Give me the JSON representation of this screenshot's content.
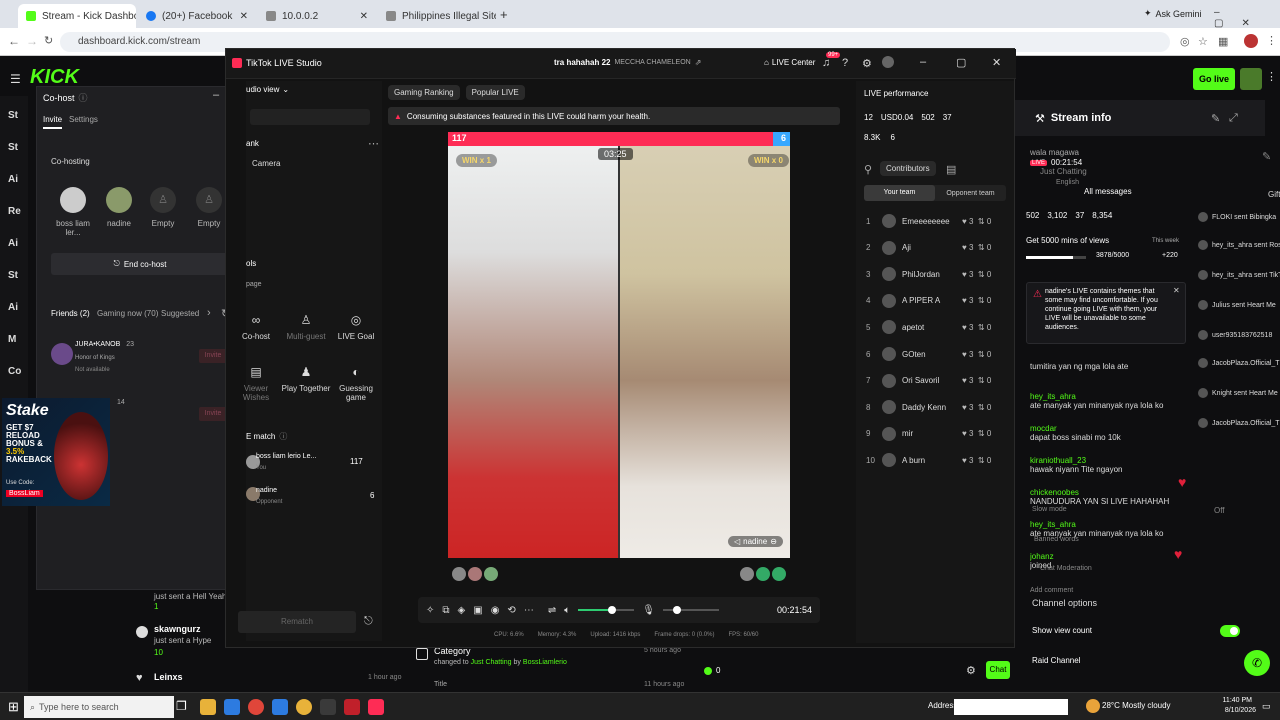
{
  "browser": {
    "tabs": [
      {
        "label": "Stream - Kick Dashboard",
        "color": "#53fc18"
      },
      {
        "label": "(20+) Facebook",
        "color": "#1877f2"
      },
      {
        "label": "10.0.0.2",
        "color": "#888888"
      },
      {
        "label": "Philippines Illegal Site Promoti",
        "color": "#888888"
      }
    ],
    "new_tab": "+",
    "url": "dashboard.kick.com/stream",
    "ask": "Ask Gemini"
  },
  "kick": {
    "logo": "KICK",
    "go_live": "Go live",
    "side_badges": [
      "St",
      "St",
      "Ai",
      "Re",
      "Ai",
      "St",
      "Ai",
      "M",
      "Co"
    ],
    "stream_info": "Stream info",
    "settings_label": "Gift",
    "cohost": {
      "title": "Co-host",
      "tabs": [
        "Invite",
        "Settings"
      ],
      "section": "Co-hosting",
      "slots": [
        {
          "label": "boss liam ler..."
        },
        {
          "label": "nadine"
        },
        {
          "label": "Empty"
        },
        {
          "label": "Empty"
        }
      ],
      "end_button": "End co-host",
      "filter_tabs": [
        "Friends (2)",
        "Gaming now (70)",
        "Suggested"
      ],
      "friends": [
        {
          "name": "JURA•KANOB",
          "count": "23",
          "game": "Honor of Kings",
          "status": "Not available",
          "action": "Invite"
        },
        {
          "name": "",
          "count": "14",
          "game": "",
          "status": "",
          "action": "Invite"
        }
      ]
    },
    "ad": {
      "brand": "Stake",
      "line1": "GET $7",
      "line2": "RELOAD",
      "line3": "BONUS &",
      "line4": "3.5%",
      "line5": "RAKEBACK",
      "code_label": "Use Code:",
      "code": "BossLiam"
    },
    "activity": [
      {
        "name": "",
        "action": "just sent a Hell Yeah",
        "amount": "1",
        "time": ""
      },
      {
        "name": "skawngurz",
        "action": "just sent a Hype",
        "amount": "10",
        "time": ""
      },
      {
        "name": "Leinxs",
        "action": "",
        "amount": "",
        "time": "1 hour ago"
      }
    ],
    "category_event": {
      "title": "Category",
      "text_prefix": "changed to",
      "category": "Just Chatting",
      "by": "by",
      "user": "BossLiamlerio",
      "time": "5 hours ago",
      "next": "Title",
      "next_time": "11 hours ago"
    },
    "stream_card": {
      "channel": "wala magawa",
      "uptime": "00:21:54",
      "category": "Just Chatting",
      "language": "English",
      "stats": [
        "502",
        "3,102",
        "37",
        "8,354"
      ]
    },
    "chat_filter": "All messages",
    "goal": {
      "text": "Get 5000 mins of views",
      "period": "This week",
      "progress": "3878/5000",
      "bonus": "+220",
      "fraction": 0.776
    },
    "warning": "nadine's LIVE contains themes that some may find uncomfortable. If you continue going LIVE with them, your LIVE will be unavailable to some audiences.",
    "chat": [
      {
        "user": "",
        "text": "tumitira yan ng mga lola ate"
      },
      {
        "user": "hey_its_ahra",
        "text": "ate manyak yan minanyak nya lola ko"
      },
      {
        "user": "mocdar",
        "text": "dapat boss sinabi mo 10k"
      },
      {
        "user": "kiraniothuall_23",
        "text": "hawak niyann Tite ngayon"
      },
      {
        "user": "chickenoobes",
        "text": "NANDUDURA YAN SI LIVE HAHAHAH"
      },
      {
        "user": "hey_its_ahra",
        "text": "ate manyak yan minanyak nya lola ko"
      },
      {
        "user": "johanz",
        "text": "joined"
      }
    ],
    "chat_side_labels": [
      "Slow mode",
      "Banned words",
      "Chat Moderation"
    ],
    "add_comment": "Add comment",
    "slow_value": "Off",
    "gifts": [
      {
        "text": "FLOKI sent Bibingka"
      },
      {
        "text": "hey_its_ahra sent Rose"
      },
      {
        "text": "hey_its_ahra sent TikTok"
      },
      {
        "text": "Julius sent Heart Me"
      },
      {
        "text": "user935183762518"
      },
      {
        "text": "JacobPlaza.Official_T"
      },
      {
        "text": "Knight sent Heart Me"
      },
      {
        "text": "JacobPlaza.Official_T"
      }
    ],
    "channel_options": "Channel options",
    "show_view_count": "Show view count",
    "raid_channel": "Raid Channel",
    "viewer_zero": "0",
    "chat_button": "Chat"
  },
  "studio": {
    "title": "TikTok LIVE Studio",
    "stream_name": "tra hahahah 22",
    "stream_sub": "MECCHA CHAMELEON",
    "live_center": "LIVE Center",
    "notif_badge": "99+",
    "audio_view": "udio view",
    "left_section": "ank",
    "camera": "Camera",
    "tools_title": "ols",
    "tools_page": "page",
    "tools": [
      {
        "label": "Co-host",
        "dim": false
      },
      {
        "label": "Multi-guest",
        "dim": true
      },
      {
        "label": "LIVE Goal",
        "dim": false
      },
      {
        "label": "Viewer Wishes",
        "dim": true
      },
      {
        "label": "Play Together",
        "dim": false
      },
      {
        "label": "Guessing game",
        "dim": false
      }
    ],
    "match_title": "E match",
    "match": [
      {
        "name": "boss liam lerio Le...",
        "role": "You",
        "score": "117",
        "color": "#ff3b6a"
      },
      {
        "name": "nadine",
        "role": "Opponent",
        "score": "6",
        "color": "#37a8ff"
      }
    ],
    "rematch": "Rematch",
    "top_tabs": [
      "Gaming Ranking",
      "Popular LIVE"
    ],
    "banner": "Consuming substances featured in this LIVE could harm your health.",
    "battle": {
      "left_score": "117",
      "right_score": "6",
      "left_win": "WIN x 1",
      "right_win": "WIN x 0",
      "timer": "03:25",
      "left_fraction": 0.95,
      "name_tag": "nadine"
    },
    "controls_time": "00:21:54",
    "stats": {
      "cpu": "CPU: 6.6%",
      "memory": "Memory: 4.3%",
      "upload": "Upload: 1416 kbps",
      "drops": "Frame drops: 0 (0.0%)",
      "fps": "FPS: 60/60"
    },
    "perf_title": "LIVE performance",
    "perf": {
      "a": "12",
      "usd": "USD0.04",
      "viewers": "502",
      "c": "37",
      "likes": "8.3K",
      "shares": "6"
    },
    "contributors": "Contributors",
    "team_tabs": [
      "Your team",
      "Opponent team"
    ],
    "ranking": [
      {
        "rank": "1",
        "name": "Emeeeeeeee",
        "s1": "3",
        "s2": "0"
      },
      {
        "rank": "2",
        "name": "Aji",
        "s1": "3",
        "s2": "0"
      },
      {
        "rank": "3",
        "name": "PhilJordan",
        "s1": "3",
        "s2": "0"
      },
      {
        "rank": "4",
        "name": "A PIPER A",
        "s1": "3",
        "s2": "0"
      },
      {
        "rank": "5",
        "name": "apetot",
        "s1": "3",
        "s2": "0"
      },
      {
        "rank": "6",
        "name": "GOten",
        "s1": "3",
        "s2": "0"
      },
      {
        "rank": "7",
        "name": "Ori Savoril",
        "s1": "3",
        "s2": "0"
      },
      {
        "rank": "8",
        "name": "Daddy Kenn",
        "s1": "3",
        "s2": "0"
      },
      {
        "rank": "9",
        "name": "mir",
        "s1": "3",
        "s2": "0"
      },
      {
        "rank": "10",
        "name": "A burn",
        "s1": "3",
        "s2": "0"
      }
    ]
  },
  "taskbar": {
    "search": "Type here to search",
    "address": "Address",
    "weather": "28°C Mostly cloudy",
    "time": "11:40 PM",
    "date": "8/10/2026"
  }
}
